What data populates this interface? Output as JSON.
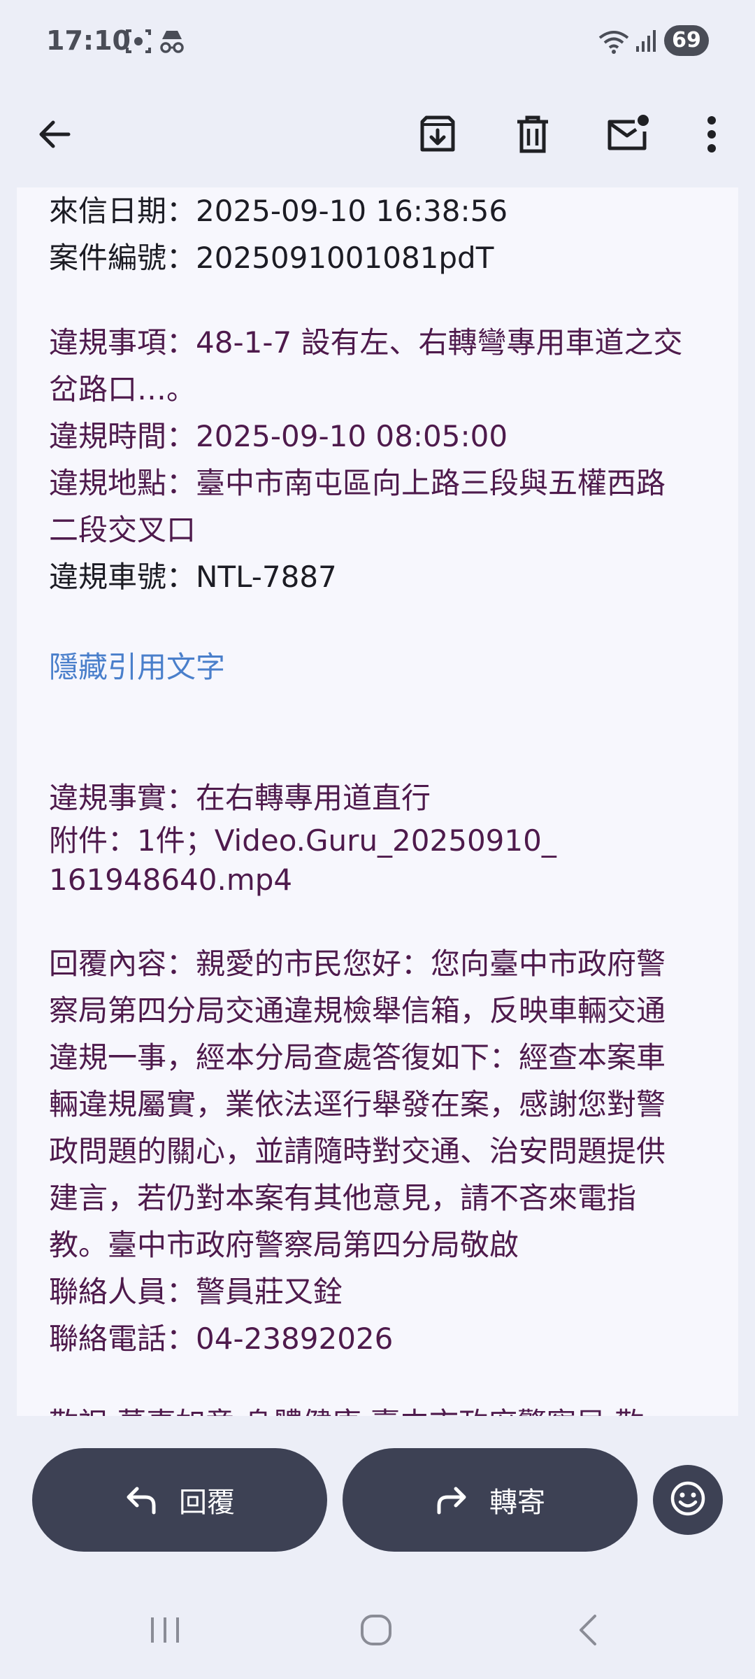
{
  "status_bar": {
    "time": "17:10",
    "icons": [
      "screenshot-icon",
      "incognito-icon",
      "wifi-icon",
      "signal-icon"
    ],
    "battery": "69"
  },
  "app_bar": {
    "icons": [
      "back-arrow-icon",
      "archive-icon",
      "delete-icon",
      "mark-unread-icon",
      "more-vert-icon"
    ]
  },
  "message": {
    "lines_top": [
      "來信日期：2025-09-10 16:38:56",
      "案件編號：2025091001081pdT"
    ],
    "violation": {
      "item_line1": "違規事項：48-1-7 設有左、右轉彎專用車道之交",
      "item_line2": "岔路口…。",
      "time": "違規時間：2025-09-10 08:05:00",
      "location_line1": "違規地點：臺中市南屯區向上路三段與五權西路",
      "location_line2": "二段交叉口",
      "plate": "違規車號：NTL-7887"
    },
    "hide_quoted": "隱藏引用文字",
    "fact": "違規事實：在右轉專用道直行",
    "attachment_line1": "附件：1件；Video.Guru_20250910_",
    "attachment_line2": "161948640.mp4",
    "reply_lines": [
      "回覆內容：親愛的市民您好：您向臺中市政府警",
      "察局第四分局交通違規檢舉信箱，反映車輛交通",
      "違規一事，經本分局查處答復如下：經查本案車",
      "輛違規屬實，業依法逕行舉發在案，感謝您對警",
      "政問題的關心，並請隨時對交通、治安問題提供",
      "建言，若仍對本案有其他意見，請不吝來電指",
      "教。臺中市政府警察局第四分局敬啟"
    ],
    "contact_person": "聯絡人員：警員莊又銓",
    "contact_phone": "聯絡電話：04-23892026",
    "cut_line": "敬祝 萬事如意 身體健康 臺中市政府警察局 敬"
  },
  "actions": {
    "reply_label": "回覆",
    "forward_label": "轉寄"
  },
  "colors": {
    "background": "#eceef7",
    "card": "#f7f7fd",
    "quoted_text": "#4e1a4c",
    "link": "#4a7fcb",
    "pill": "#3d4154"
  }
}
